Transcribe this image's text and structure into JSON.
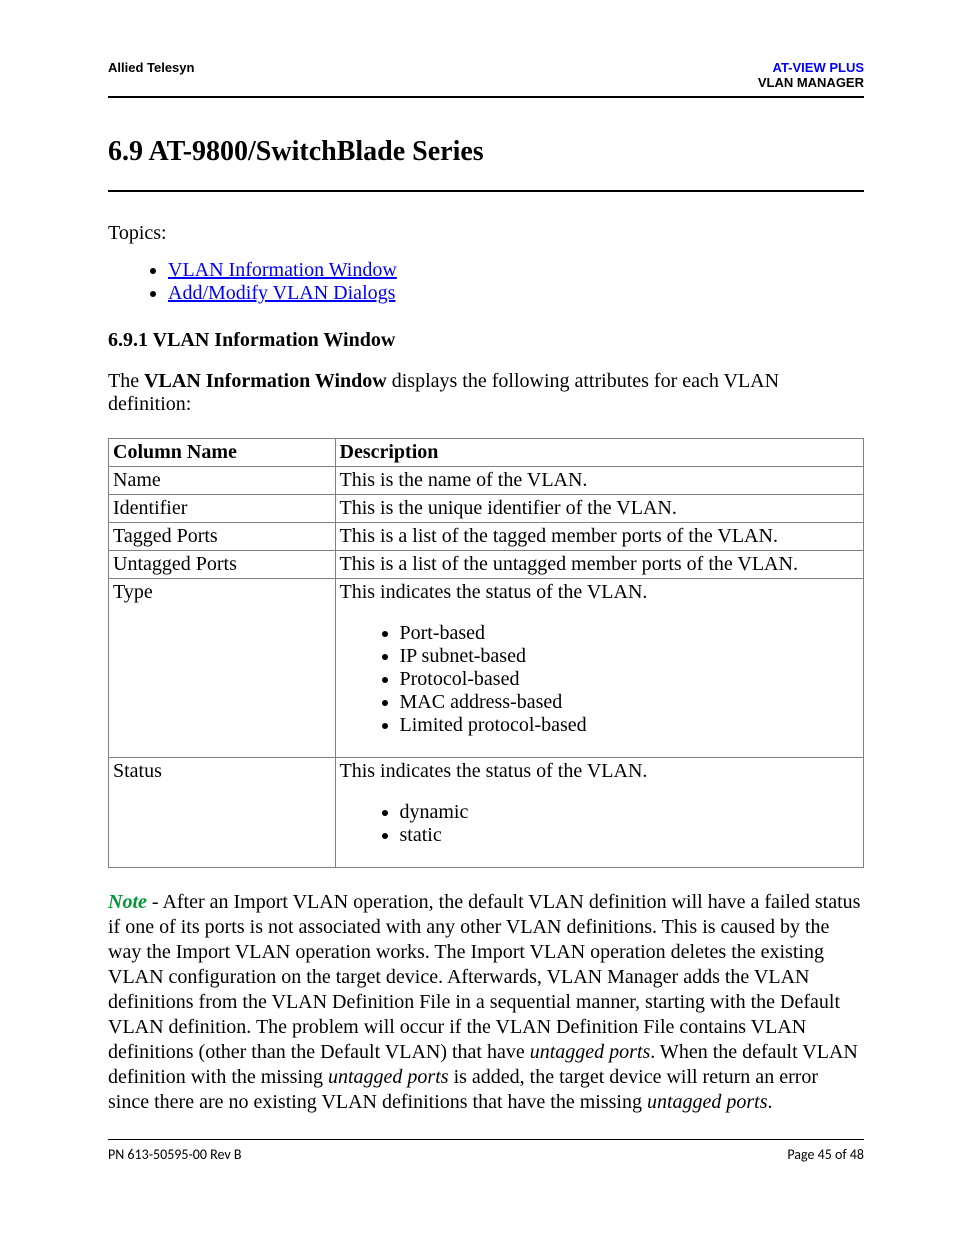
{
  "header": {
    "left": "Allied Telesyn",
    "right_line1": "AT-VIEW PLUS",
    "right_line2": "VLAN MANAGER"
  },
  "title": "6.9 AT-9800/SwitchBlade Series",
  "topics_label": "Topics:",
  "topics": [
    "VLAN Information Window",
    "Add/Modify VLAN Dialogs"
  ],
  "subheading": "6.9.1 VLAN Information Window",
  "intro": {
    "pre": "The ",
    "bold": "VLAN Information Window",
    "post": " displays the following attributes for each VLAN definition:"
  },
  "table": {
    "header": {
      "col1": "Column Name",
      "col2": "Description"
    },
    "rows": [
      {
        "name": "Name",
        "desc": "This is the name of the VLAN."
      },
      {
        "name": "Identifier",
        "desc": "This is the unique identifier of the VLAN."
      },
      {
        "name": "Tagged Ports",
        "desc": "This is a list of the tagged member ports of the VLAN."
      },
      {
        "name": "Untagged Ports",
        "desc": "This is a list of the untagged member ports of the VLAN."
      }
    ],
    "type_row": {
      "name": "Type",
      "lead": "This indicates the status of the VLAN.",
      "items": [
        "Port-based",
        "IP subnet-based",
        "Protocol-based",
        "MAC address-based",
        "Limited protocol-based"
      ]
    },
    "status_row": {
      "name": "Status",
      "lead": "This indicates the status of the VLAN.",
      "items": [
        "dynamic",
        "static"
      ]
    }
  },
  "note": {
    "label": "Note",
    "seg1": " - After an Import VLAN operation, the default VLAN definition will have a failed status if one of its ports is not associated with any other VLAN definitions. This is caused by the way the Import VLAN operation works. The Import VLAN operation deletes the existing VLAN configuration on the target device. Afterwards, VLAN Manager adds the VLAN definitions from the VLAN Definition File in a sequential manner, starting with the Default VLAN definition. The problem will occur if the VLAN Definition File contains VLAN definitions (other than the Default VLAN) that have ",
    "italic1": "untagged ports",
    "seg2": ". When the default VLAN definition with the missing ",
    "italic2": "untagged ports",
    "seg3": " is added, the target device will return an error since there are no existing VLAN definitions that have the missing ",
    "italic3": "untagged ports",
    "seg4": "."
  },
  "footer": {
    "left": "PN 613-50595-00 Rev B",
    "right": "Page 45 of 48"
  }
}
